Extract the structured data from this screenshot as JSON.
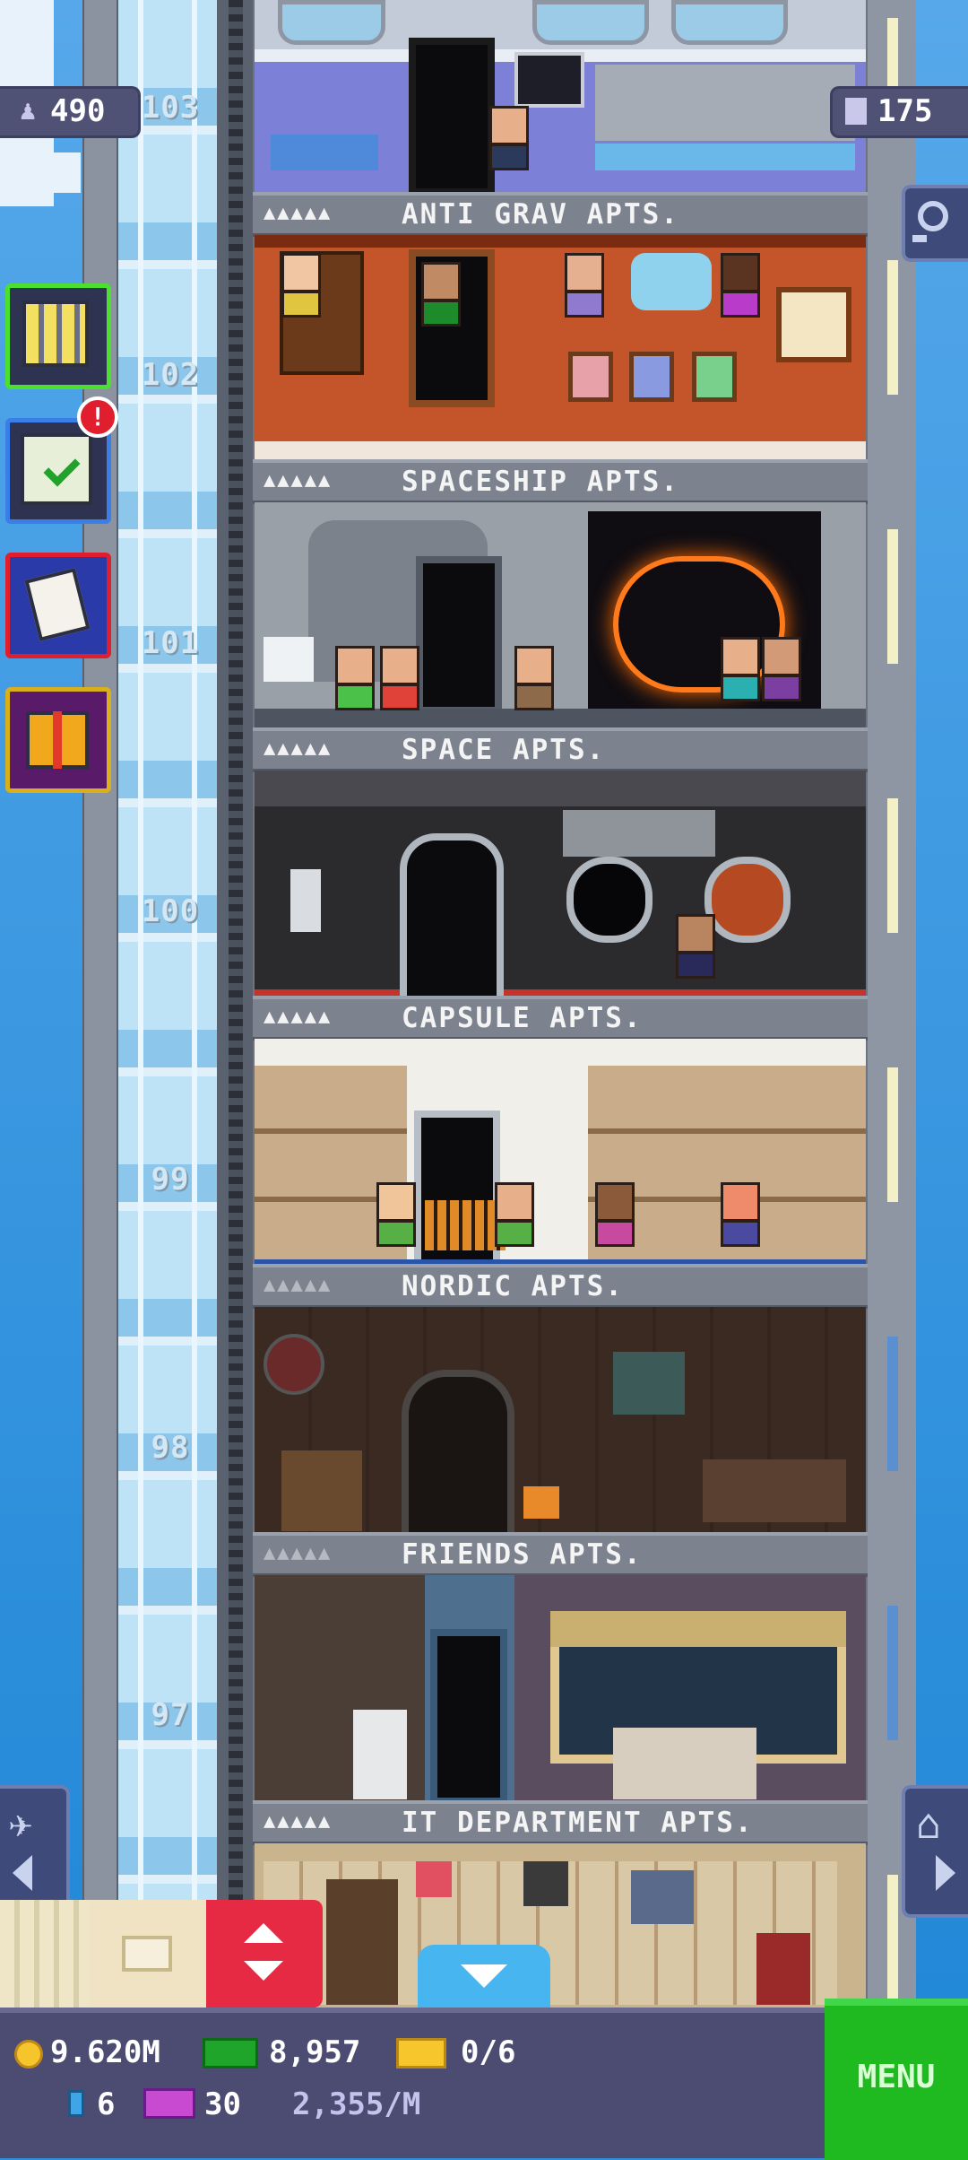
{
  "hud": {
    "population": "490",
    "floors": "175",
    "coins": "9.620M",
    "bux": "8,957",
    "tickets": "0/6",
    "elevator_level": "6",
    "golden_tickets": "30",
    "income": "2,355/M",
    "menu_label": "MENU",
    "notification_count": "!"
  },
  "floors": [
    {
      "number": "103",
      "name": "ANTI GRAV APTS.",
      "dots": "▲▲▲▲▲",
      "bg": "#c3cbd8",
      "accent": "#6f73c8"
    },
    {
      "number": "102",
      "name": "SPACESHIP APTS.",
      "dots": "▲▲▲▲▲",
      "bg": "#c4542a",
      "accent": "#9a3a1a"
    },
    {
      "number": "101",
      "name": "SPACE APTS.",
      "dots": "▲▲▲▲▲",
      "bg": "#9aa0a8",
      "accent": "#2b2d33"
    },
    {
      "number": "100",
      "name": "CAPSULE APTS.",
      "dots": "▲▲▲▲▲",
      "bg": "#2b2b2e",
      "accent": "#c4342c"
    },
    {
      "number": "99",
      "name": "NORDIC APTS.",
      "dots": "▲▲▲▲▲",
      "bg": "#c9ad8b",
      "accent": "#f1efe9"
    },
    {
      "number": "98",
      "name": "FRIENDS APTS.",
      "dots": "▲▲▲▲▲",
      "bg": "#3a2a22",
      "accent": "#5a3f30"
    },
    {
      "number": "97",
      "name": "IT DEPARTMENT APTS.",
      "dots": "▲▲▲▲▲",
      "bg": "#5b4d60",
      "accent": "#4f6f8f"
    },
    {
      "number": "",
      "name": "",
      "dots": "",
      "bg": "#c9b48e",
      "accent": "#7a5a3a"
    }
  ],
  "colors": {
    "sky": "#2f8fdc",
    "menu_green": "#1fba1f",
    "bar_bg": "#4c4b72",
    "lobby_red": "#e11e2e"
  },
  "icons": {
    "population": "person-icon",
    "floors": "building-icon",
    "search": "magnifier-icon",
    "lobby": "building-grid-icon",
    "missions": "checklist-icon",
    "calendar": "calendar-icon",
    "gift": "gift-icon",
    "plane": "plane-icon",
    "home": "home-icon"
  }
}
